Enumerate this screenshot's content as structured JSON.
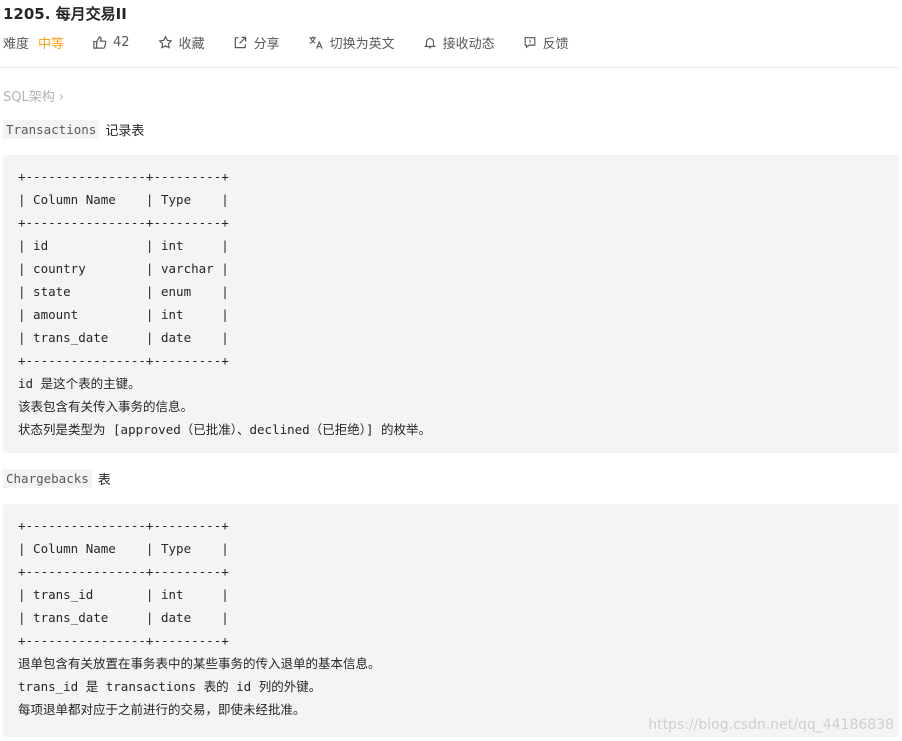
{
  "title": "1205. 每月交易II",
  "toolbar": {
    "difficulty_label": "难度",
    "difficulty_value": "中等",
    "likes": "42",
    "favorite": "收藏",
    "share": "分享",
    "switch_lang": "切换为英文",
    "notify": "接收动态",
    "feedback": "反馈"
  },
  "tag": "SQL架构 ›",
  "section1": {
    "code": "Transactions",
    "text": "记录表",
    "lines": [
      "+----------------+---------+",
      "| Column Name    | Type    |",
      "+----------------+---------+",
      "| id             | int     |",
      "| country        | varchar |",
      "| state          | enum    |",
      "| amount         | int     |",
      "| trans_date     | date    |",
      "+----------------+---------+",
      "id 是这个表的主键。",
      "该表包含有关传入事务的信息。",
      "状态列是类型为 [approved（已批准）、declined（已拒绝）] 的枚举。"
    ]
  },
  "section2": {
    "code": "Chargebacks",
    "text": "表",
    "lines": [
      "+----------------+---------+",
      "| Column Name    | Type    |",
      "+----------------+---------+",
      "| trans_id       | int     |",
      "| trans_date     | date    |",
      "+----------------+---------+",
      "退单包含有关放置在事务表中的某些事务的传入退单的基本信息。",
      "trans_id 是 transactions 表的 id 列的外键。",
      "每项退单都对应于之前进行的交易，即使未经批准。"
    ]
  },
  "watermark": "https://blog.csdn.net/qq_44186838"
}
